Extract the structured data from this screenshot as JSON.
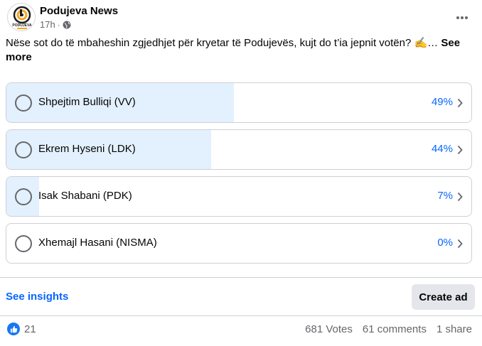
{
  "post": {
    "page_name": "Podujeva News",
    "logo_text": "PODUJEVA",
    "time": "17h",
    "separator": "·",
    "text": "Nëse sot do të mbaheshin zgjedhjet për kryetar të Podujevës, kujt do t’ia jepnit votën? ✍️…",
    "see_more": "See more"
  },
  "poll": {
    "options": [
      {
        "label": "Shpejtim Bulliqi (VV)",
        "percent_text": "49%",
        "percent": 49
      },
      {
        "label": "Ekrem Hyseni (LDK)",
        "percent_text": "44%",
        "percent": 44
      },
      {
        "label": "Isak Shabani (PDK)",
        "percent_text": "7%",
        "percent": 7
      },
      {
        "label": "Xhemajl Hasani (NISMA)",
        "percent_text": "0%",
        "percent": 0
      }
    ]
  },
  "actions": {
    "see_insights": "See insights",
    "create_ad": "Create ad"
  },
  "footer": {
    "reaction_count": "21",
    "votes": "681 Votes",
    "comments": "61 comments",
    "shares": "1 share"
  },
  "colors": {
    "accent": "#0866ff",
    "poll_fill": "#e3f0fd",
    "like_blue": "#1877f2",
    "logo_orange": "#f5a623"
  },
  "icons": {
    "privacy": "globe-icon",
    "menu": "more-horizontal-icon",
    "option_arrow": "chevron-right-icon",
    "reaction": "like-icon"
  }
}
